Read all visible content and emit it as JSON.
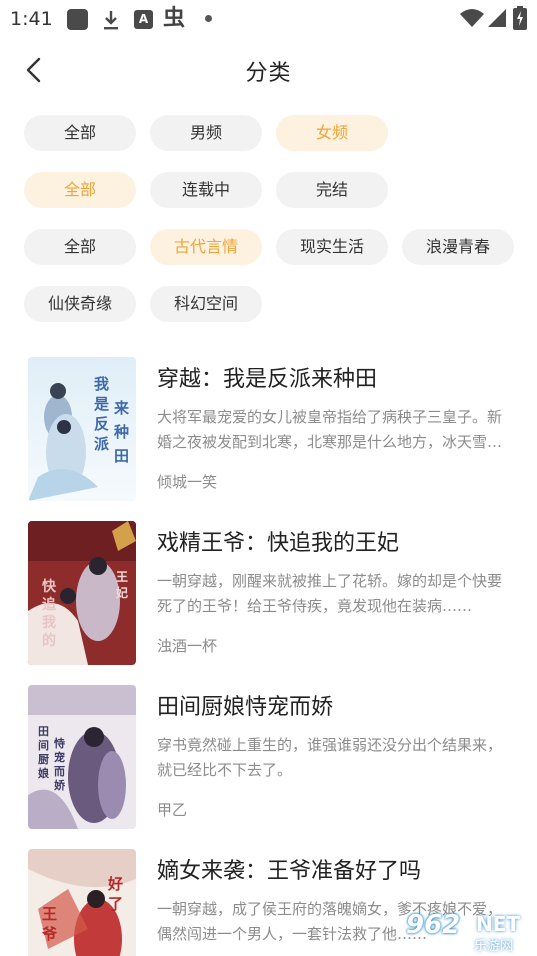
{
  "status_bar": {
    "time": "1:41",
    "icons": [
      "app-square-icon",
      "download-icon",
      "a-badge-icon",
      "bug-icon",
      "dot-icon",
      "wifi-icon",
      "signal-icon",
      "battery-charging-icon"
    ],
    "a_badge": "A",
    "bug_glyph": "虫"
  },
  "header": {
    "back_icon": "chevron-left-icon",
    "title": "分类"
  },
  "filters": {
    "gender": [
      {
        "label": "全部",
        "active": false
      },
      {
        "label": "男频",
        "active": false
      },
      {
        "label": "女频",
        "active": true
      }
    ],
    "status": [
      {
        "label": "全部",
        "active": true
      },
      {
        "label": "连载中",
        "active": false
      },
      {
        "label": "完结",
        "active": false
      }
    ],
    "genre": [
      {
        "label": "全部",
        "active": false
      },
      {
        "label": "古代言情",
        "active": true
      },
      {
        "label": "现实生活",
        "active": false
      },
      {
        "label": "浪漫青春",
        "active": false
      },
      {
        "label": "仙侠奇缘",
        "active": false
      },
      {
        "label": "科幻空间",
        "active": false
      }
    ],
    "accent_color": "#f0a43a",
    "accent_bg": "#fdf1df"
  },
  "books": [
    {
      "title": "穿越：我是反派来种田",
      "desc": "大将军最宠爱的女儿被皇帝指给了病秧子三皇子。新婚之夜被发配到北寒，北寒那是什么地方，冰天雪地寸草不生……",
      "author": "倾城一笑",
      "cover_text": "我是反派来种田"
    },
    {
      "title": "戏精王爷：快追我的王妃",
      "desc": "一朝穿越，刚醒来就被推上了花轿。嫁的却是个快要死了的王爷！给王爷侍疾，竟发现他在装病……",
      "author": "浊酒一杯",
      "cover_text": "快追我的王妃"
    },
    {
      "title": "田间厨娘恃宠而娇",
      "desc": "穿书竟然碰上重生的，谁强谁弱还没分出个结果来，就已经比不下去了。",
      "author": "甲乙",
      "cover_text": "田间厨娘恃宠而娇"
    },
    {
      "title": "嫡女来袭：王爷准备好了吗",
      "desc": "一朝穿越，成了侯王府的落魄嫡女，爹不疼娘不爱，偶然闯进一个男人，一套针法救了他……",
      "author": "",
      "cover_text": "王爷准备好了吗"
    }
  ],
  "watermark": {
    "number": "962",
    "net": "NET",
    "sub": "乐游网"
  }
}
